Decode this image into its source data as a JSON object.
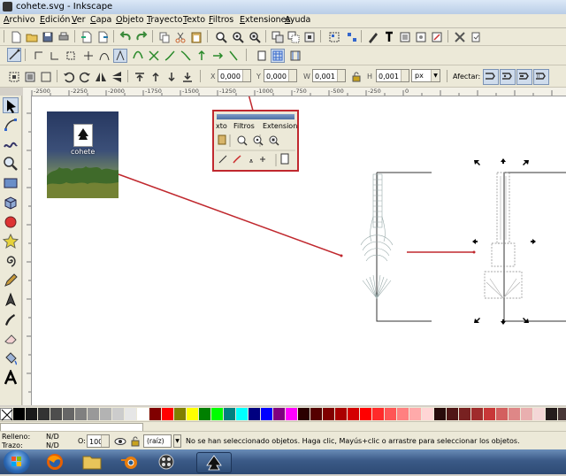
{
  "window": {
    "title": "cohete.svg - Inkscape"
  },
  "menu": [
    "Archivo",
    "Edición",
    "Ver",
    "Capa",
    "Objeto",
    "Trayecto",
    "Texto",
    "Filtros",
    "Extensiones",
    "Ayuda"
  ],
  "tool_controls": {
    "x_label": "X",
    "x_value": "0,000",
    "y_label": "Y",
    "y_value": "0,000",
    "w_label": "W",
    "w_value": "0,001",
    "h_label": "H",
    "h_value": "0,001",
    "unit": "px",
    "affect_label": "Afectar:"
  },
  "rulers": {
    "h_ticks": [
      "-2500",
      "-2250",
      "-2000",
      "-1750",
      "-1500",
      "-1250",
      "-1000",
      "-750",
      "-500",
      "-250",
      "0"
    ]
  },
  "canvas": {
    "thumbnail_label": "cohete",
    "callout_menu": [
      "xto",
      "Filtros",
      "Extension"
    ]
  },
  "statusbar": {
    "fill_label": "Relleno:",
    "fill_value": "N/D",
    "stroke_label": "Trazo:",
    "stroke_value": "N/D",
    "opacity_label": "O:",
    "opacity_value": "100",
    "layer": "(raíz)",
    "message": "No se han seleccionado objetos. Haga clic, Mayús+clic o arrastre para seleccionar los objetos."
  },
  "palette": [
    "#000000",
    "#1a1a1a",
    "#333333",
    "#4d4d4d",
    "#666666",
    "#808080",
    "#999999",
    "#b3b3b3",
    "#cccccc",
    "#e6e6e6",
    "#ffffff",
    "#800000",
    "#ff0000",
    "#808000",
    "#ffff00",
    "#008000",
    "#00ff00",
    "#008080",
    "#00ffff",
    "#000080",
    "#0000ff",
    "#800080",
    "#ff00ff",
    "#2b0000",
    "#550000",
    "#800000",
    "#aa0000",
    "#d40000",
    "#ff0000",
    "#ff2a2a",
    "#ff5555",
    "#ff8080",
    "#ffaaaa",
    "#ffd5d5",
    "#280b0b",
    "#501616",
    "#782121",
    "#a02c2c",
    "#c83737",
    "#d35f5f",
    "#de8787",
    "#e9afaf",
    "#f4d7d7",
    "#241c1c",
    "#483737"
  ],
  "colors": {
    "accent_red": "#c0282e",
    "selection": "#000000"
  }
}
